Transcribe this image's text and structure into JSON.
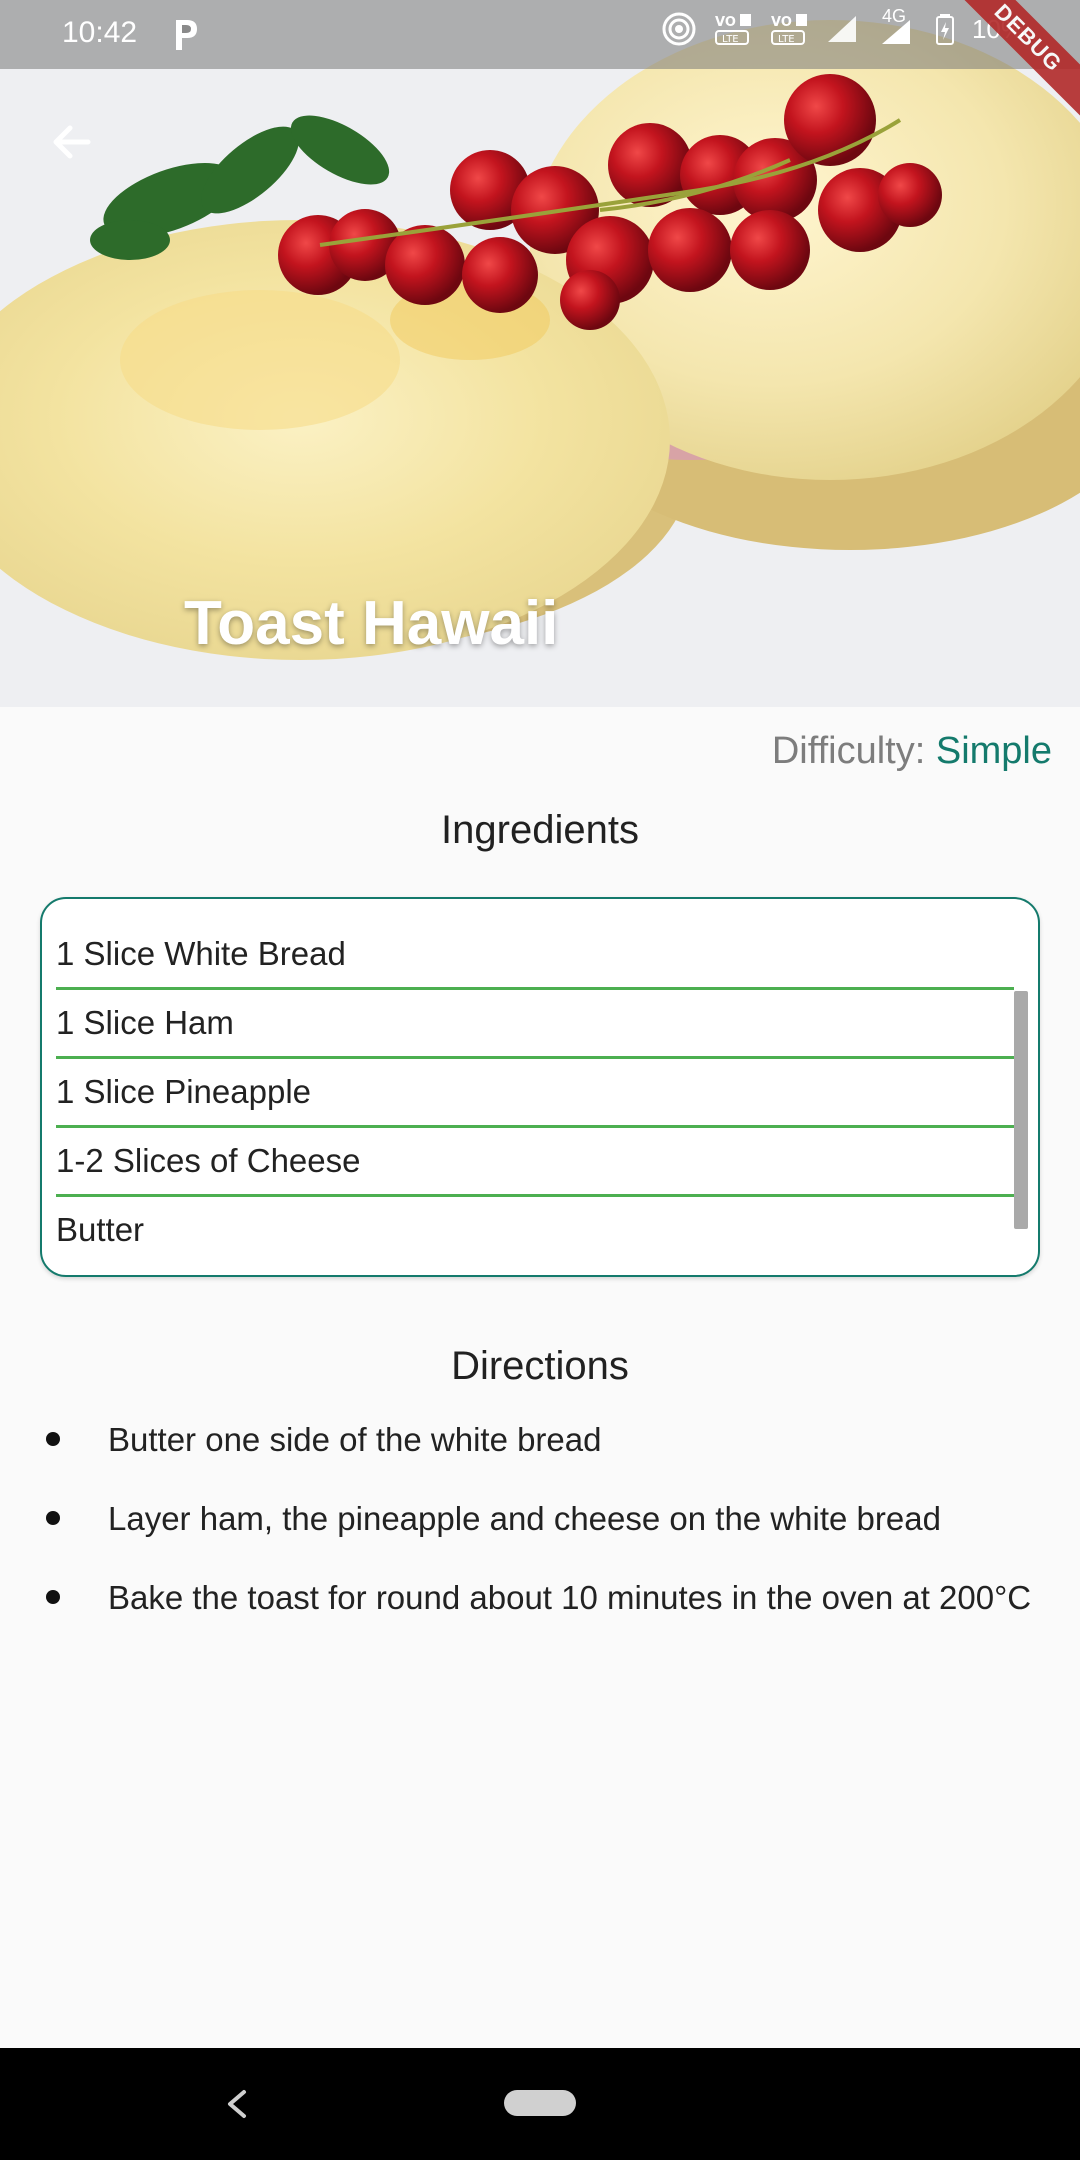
{
  "status_bar": {
    "time": "10:42",
    "network_label": "4G",
    "battery": "10%",
    "icons": [
      "parking-app-icon",
      "hotspot-icon",
      "volte-1-icon",
      "volte-2-icon",
      "signal-icon",
      "signal-4g-icon",
      "battery-icon"
    ]
  },
  "debug_banner": "DEBUG",
  "recipe": {
    "title": "Toast Hawaii",
    "difficulty_label": "Difficulty:",
    "difficulty_value": "Simple"
  },
  "ingredients": {
    "title": "Ingredients",
    "items": [
      "1 Slice White Bread",
      "1 Slice Ham",
      "1 Slice Pineapple",
      "1-2 Slices of Cheese",
      "Butter"
    ]
  },
  "directions": {
    "title": "Directions",
    "steps": [
      "Butter one side of the white bread",
      "Layer ham, the pineapple and cheese on the white bread",
      "Bake the toast for round about 10 minutes in the oven at 200°C"
    ]
  },
  "colors": {
    "accent": "#147a6c",
    "divider": "#4caf50",
    "muted": "#7d7d7d"
  }
}
